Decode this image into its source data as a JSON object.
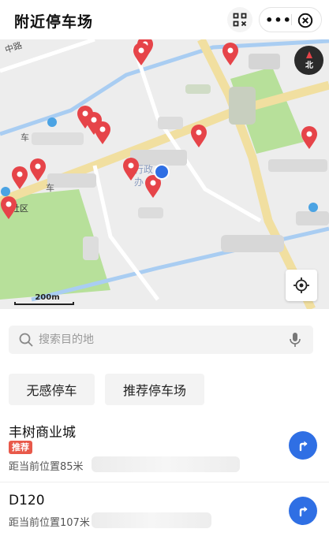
{
  "header": {
    "title": "附近停车场",
    "more_label": "•••"
  },
  "map": {
    "compass_label": "北",
    "scale_label": "200m",
    "labels": {
      "road_top_left": "中路",
      "left_mid": "车",
      "left_mid2": "车",
      "center": "行政",
      "center2": "办",
      "community": "社区"
    },
    "colors": {
      "pin": "#e64449",
      "user_location": "#2f6fe4",
      "green": "#b7e09a",
      "water": "#a9cdf2",
      "road": "#f1dfa0"
    }
  },
  "search": {
    "placeholder": "搜索目的地",
    "value": ""
  },
  "filters": [
    "无感停车",
    "推荐停车场"
  ],
  "lots": [
    {
      "name": "丰树商业城",
      "badge": "推荐",
      "distance": "距当前位置85米"
    },
    {
      "name": "D120",
      "badge": "",
      "distance": "距当前位置107米"
    }
  ],
  "icons": {
    "scan": "scan-icon",
    "close": "close-icon",
    "search": "search-icon",
    "mic": "microphone-icon",
    "locate": "locate-icon",
    "navigate": "navigate-icon"
  }
}
